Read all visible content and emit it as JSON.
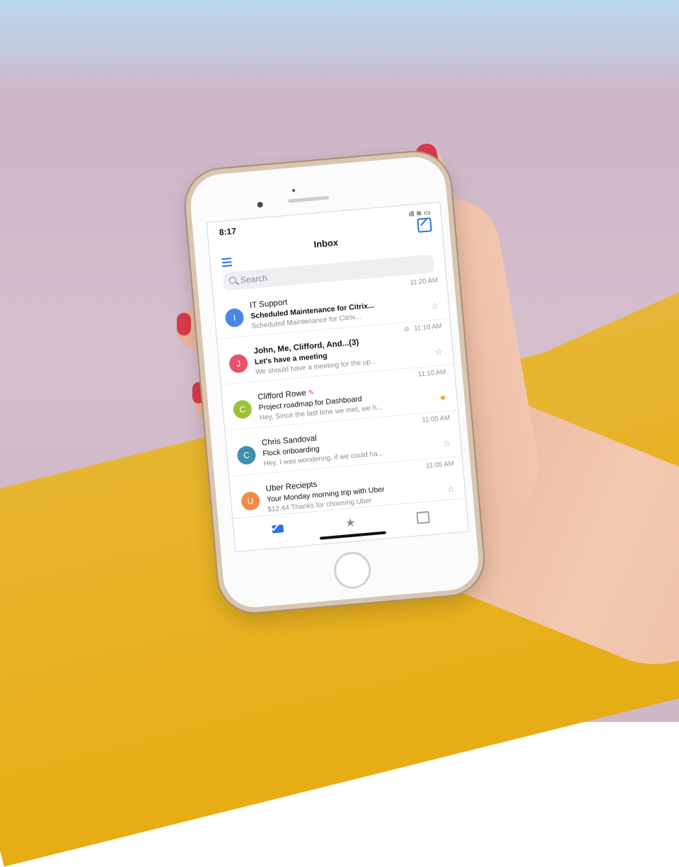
{
  "status": {
    "time": "8:17",
    "icons": "ıll ≋ ▭"
  },
  "header": {
    "title": "Inbox"
  },
  "search": {
    "placeholder": "Search"
  },
  "emails": [
    {
      "avatar": "I",
      "avatar_color": "#4a86e8",
      "sender": "IT Support",
      "subject": "Scheduled Maintenance for Citrix...",
      "preview": "Scheduled Maintenance for Citrix...",
      "time": "11:20 AM",
      "starred": false
    },
    {
      "avatar": "J",
      "avatar_color": "#e8506b",
      "sender": "John, Me, Clifford, And...(3)",
      "subject": "Let's have a meeting",
      "preview": "We should have a meeting for the up...",
      "time": "11:10 AM",
      "starred": false
    },
    {
      "avatar": "C",
      "avatar_color": "#9ac53a",
      "sender": "Clifford Rowe",
      "subject": "Project roadmap for Dashboard",
      "preview": "Hey, Since the last time we met, we h...",
      "time": "11:10 AM",
      "starred": true
    },
    {
      "avatar": "C",
      "avatar_color": "#3f8fb0",
      "sender": "Chris Sandoval",
      "subject": "Flock onboarding",
      "preview": "Hey, I was wondering, if we could ha...",
      "time": "11:05 AM",
      "starred": false
    },
    {
      "avatar": "U",
      "avatar_color": "#f08a46",
      "sender": "Uber Reciepts",
      "subject": "Your Monday morning trip with Uber",
      "preview": "$12.44 Thanks for choosing Uber",
      "time": "11:05 AM",
      "starred": false
    }
  ],
  "icons": {
    "star_on": "★",
    "star_off": "☆",
    "clip": "⊘",
    "pencil": "✎",
    "star_tab": "★"
  },
  "colors": {
    "accent": "#2f6fe4",
    "star": "#f39c24"
  }
}
